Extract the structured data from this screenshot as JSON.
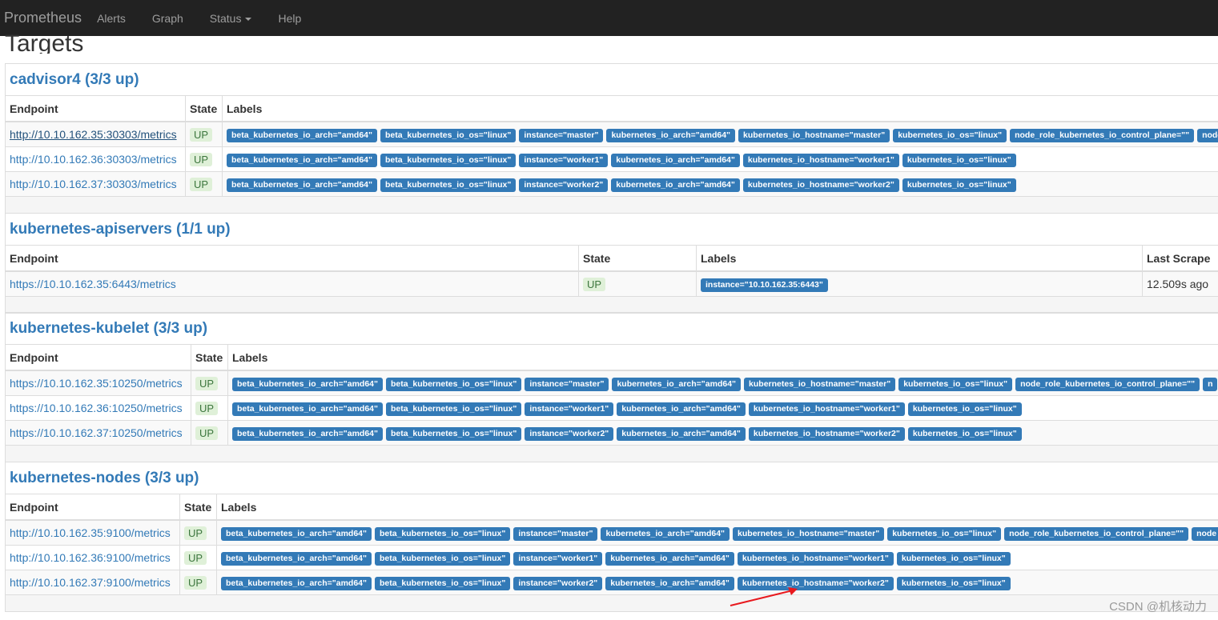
{
  "nav": {
    "brand": "Prometheus",
    "items": [
      "Alerts",
      "Graph",
      "Status",
      "Help"
    ]
  },
  "page_title": "Targets",
  "jobs": [
    {
      "title": "cadvisor4 (3/3 up)",
      "headers": [
        "Endpoint",
        "State",
        "Labels"
      ],
      "rows": [
        {
          "endpoint": "http://10.10.162.35:30303/metrics",
          "state": "UP",
          "labels": [
            "beta_kubernetes_io_arch=\"amd64\"",
            "beta_kubernetes_io_os=\"linux\"",
            "instance=\"master\"",
            "kubernetes_io_arch=\"amd64\"",
            "kubernetes_io_hostname=\"master\"",
            "kubernetes_io_os=\"linux\"",
            "node_role_kubernetes_io_control_plane=\"\"",
            "node"
          ]
        },
        {
          "endpoint": "http://10.10.162.36:30303/metrics",
          "state": "UP",
          "labels": [
            "beta_kubernetes_io_arch=\"amd64\"",
            "beta_kubernetes_io_os=\"linux\"",
            "instance=\"worker1\"",
            "kubernetes_io_arch=\"amd64\"",
            "kubernetes_io_hostname=\"worker1\"",
            "kubernetes_io_os=\"linux\""
          ]
        },
        {
          "endpoint": "http://10.10.162.37:30303/metrics",
          "state": "UP",
          "labels": [
            "beta_kubernetes_io_arch=\"amd64\"",
            "beta_kubernetes_io_os=\"linux\"",
            "instance=\"worker2\"",
            "kubernetes_io_arch=\"amd64\"",
            "kubernetes_io_hostname=\"worker2\"",
            "kubernetes_io_os=\"linux\""
          ]
        }
      ]
    },
    {
      "title": "kubernetes-apiservers (1/1 up)",
      "headers": [
        "Endpoint",
        "State",
        "Labels",
        "Last Scrape"
      ],
      "rows": [
        {
          "endpoint": "https://10.10.162.35:6443/metrics",
          "state": "UP",
          "labels": [
            "instance=\"10.10.162.35:6443\""
          ],
          "last_scrape": "12.509s ago"
        }
      ]
    },
    {
      "title": "kubernetes-kubelet (3/3 up)",
      "headers": [
        "Endpoint",
        "State",
        "Labels"
      ],
      "rows": [
        {
          "endpoint": "https://10.10.162.35:10250/metrics",
          "state": "UP",
          "labels": [
            "beta_kubernetes_io_arch=\"amd64\"",
            "beta_kubernetes_io_os=\"linux\"",
            "instance=\"master\"",
            "kubernetes_io_arch=\"amd64\"",
            "kubernetes_io_hostname=\"master\"",
            "kubernetes_io_os=\"linux\"",
            "node_role_kubernetes_io_control_plane=\"\"",
            "n"
          ]
        },
        {
          "endpoint": "https://10.10.162.36:10250/metrics",
          "state": "UP",
          "labels": [
            "beta_kubernetes_io_arch=\"amd64\"",
            "beta_kubernetes_io_os=\"linux\"",
            "instance=\"worker1\"",
            "kubernetes_io_arch=\"amd64\"",
            "kubernetes_io_hostname=\"worker1\"",
            "kubernetes_io_os=\"linux\""
          ]
        },
        {
          "endpoint": "https://10.10.162.37:10250/metrics",
          "state": "UP",
          "labels": [
            "beta_kubernetes_io_arch=\"amd64\"",
            "beta_kubernetes_io_os=\"linux\"",
            "instance=\"worker2\"",
            "kubernetes_io_arch=\"amd64\"",
            "kubernetes_io_hostname=\"worker2\"",
            "kubernetes_io_os=\"linux\""
          ]
        }
      ]
    },
    {
      "title": "kubernetes-nodes (3/3 up)",
      "headers": [
        "Endpoint",
        "State",
        "Labels"
      ],
      "rows": [
        {
          "endpoint": "http://10.10.162.35:9100/metrics",
          "state": "UP",
          "labels": [
            "beta_kubernetes_io_arch=\"amd64\"",
            "beta_kubernetes_io_os=\"linux\"",
            "instance=\"master\"",
            "kubernetes_io_arch=\"amd64\"",
            "kubernetes_io_hostname=\"master\"",
            "kubernetes_io_os=\"linux\"",
            "node_role_kubernetes_io_control_plane=\"\"",
            "node"
          ]
        },
        {
          "endpoint": "http://10.10.162.36:9100/metrics",
          "state": "UP",
          "labels": [
            "beta_kubernetes_io_arch=\"amd64\"",
            "beta_kubernetes_io_os=\"linux\"",
            "instance=\"worker1\"",
            "kubernetes_io_arch=\"amd64\"",
            "kubernetes_io_hostname=\"worker1\"",
            "kubernetes_io_os=\"linux\""
          ]
        },
        {
          "endpoint": "http://10.10.162.37:9100/metrics",
          "state": "UP",
          "labels": [
            "beta_kubernetes_io_arch=\"amd64\"",
            "beta_kubernetes_io_os=\"linux\"",
            "instance=\"worker2\"",
            "kubernetes_io_arch=\"amd64\"",
            "kubernetes_io_hostname=\"worker2\"",
            "kubernetes_io_os=\"linux\""
          ]
        }
      ]
    }
  ],
  "watermark": "CSDN @机核动力",
  "colors": {
    "navbar": "#222222",
    "link": "#337ab7",
    "label": "#337ab7",
    "up_bg": "#dff0d8",
    "up_text": "#3c763d",
    "arrow": "#e8191e"
  }
}
